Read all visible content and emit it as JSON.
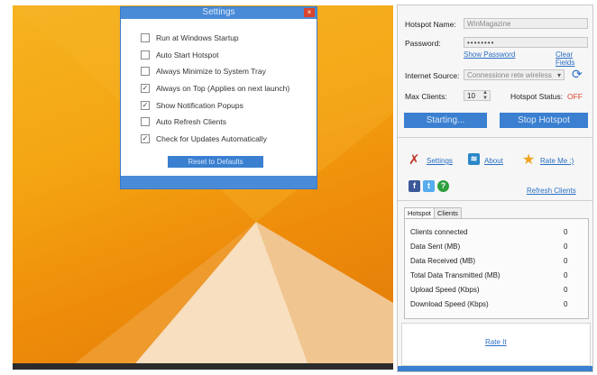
{
  "settings": {
    "title": "Settings",
    "close": "×",
    "options": [
      {
        "label": "Run at Windows Startup",
        "checked": false
      },
      {
        "label": "Auto Start Hotspot",
        "checked": false
      },
      {
        "label": "Always Minimize to System Tray",
        "checked": false
      },
      {
        "label": "Always on Top (Applies on next launch)",
        "checked": true
      },
      {
        "label": "Show Notification Popups",
        "checked": true
      },
      {
        "label": "Auto Refresh Clients",
        "checked": false
      },
      {
        "label": "Check for Updates Automatically",
        "checked": true
      }
    ],
    "reset_label": "Reset to Defaults"
  },
  "hotspot": {
    "name_label": "Hotspot Name:",
    "name_value": "WinMagazine",
    "password_label": "Password:",
    "password_value": "••••••••",
    "show_password": "Show Password",
    "clear_fields": "Clear Fields",
    "source_label": "Internet Source:",
    "source_value": "Connessione rete wireless",
    "max_clients_label": "Max Clients:",
    "max_clients_value": "10",
    "status_label": "Hotspot Status:",
    "status_value": "OFF",
    "starting_label": "Starting...",
    "stop_label": "Stop Hotspot"
  },
  "links": {
    "settings": "Settings",
    "about": "About",
    "rate": "Rate Me :)",
    "refresh": "Refresh Clients"
  },
  "tabs": [
    "Hotspot",
    "Clients"
  ],
  "stats": [
    {
      "label": "Clients connected",
      "value": "0"
    },
    {
      "label": "Data Sent (MB)",
      "value": "0"
    },
    {
      "label": "Data Received (MB)",
      "value": "0"
    },
    {
      "label": "Total Data Transmitted (MB)",
      "value": "0"
    },
    {
      "label": "Upload Speed (Kbps)",
      "value": "0"
    },
    {
      "label": "Download Speed (Kbps)",
      "value": "0"
    }
  ],
  "footer_link": "Rate It",
  "colors": {
    "accent": "#3a7fd0",
    "status_off": "#e0442c",
    "wallpaper": "#f4a512"
  }
}
